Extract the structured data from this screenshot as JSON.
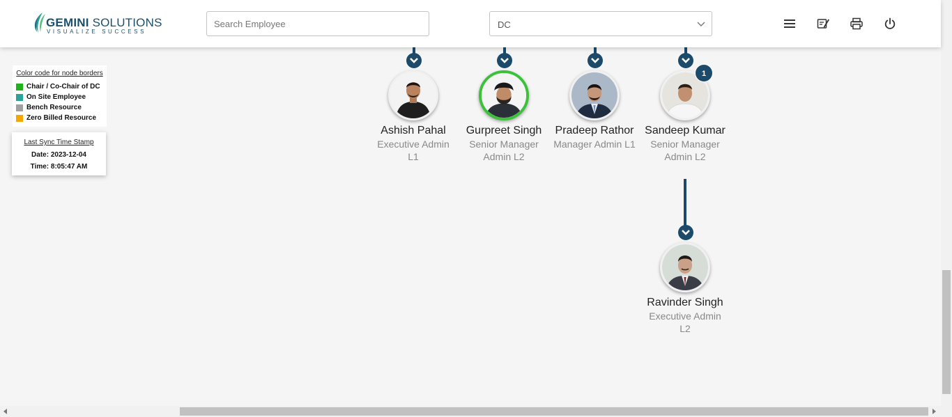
{
  "header": {
    "logo": {
      "name_bold": "GEMINI",
      "name_rest": " SOLUTIONS",
      "tagline": "VISUALIZE SUCCESS"
    },
    "search": {
      "placeholder": "Search Employee",
      "value": ""
    },
    "department_select": {
      "value": "DC"
    },
    "icons": [
      "menu-icon",
      "edit-note-icon",
      "print-icon",
      "power-icon"
    ]
  },
  "legend": {
    "title": "Color code for node borders",
    "items": [
      {
        "label": "Chair / Co-Chair of DC",
        "color": "#22b21d"
      },
      {
        "label": "On Site Employee",
        "color": "#2aa39a"
      },
      {
        "label": "Bench Resource",
        "color": "#a0a0a0"
      },
      {
        "label": "Zero Billed Resource",
        "color": "#f5a700"
      }
    ]
  },
  "sync": {
    "title": "Last Sync Time Stamp",
    "date": "Date: 2023-12-04",
    "time": "Time: 8:05:47 AM"
  },
  "nodes": [
    {
      "name": "Ashish Pahal",
      "role_line1": "Executive Admin",
      "role_line2": "L1",
      "border": "default"
    },
    {
      "name": "Gurpreet Singh",
      "role_line1": "Senior Manager",
      "role_line2": "Admin L2",
      "border": "chair"
    },
    {
      "name": "Pradeep Rathor",
      "role_line1": "Manager Admin L1",
      "role_line2": "",
      "border": "default"
    },
    {
      "name": "Sandeep Kumar",
      "role_line1": "Senior Manager",
      "role_line2": "Admin L2",
      "border": "default",
      "badge": "1"
    },
    {
      "name": "Ravinder Singh",
      "role_line1": "Executive Admin",
      "role_line2": "L2",
      "border": "default"
    }
  ],
  "colors": {
    "accent": "#1b4a6b",
    "chair_border": "#3cc13b"
  }
}
